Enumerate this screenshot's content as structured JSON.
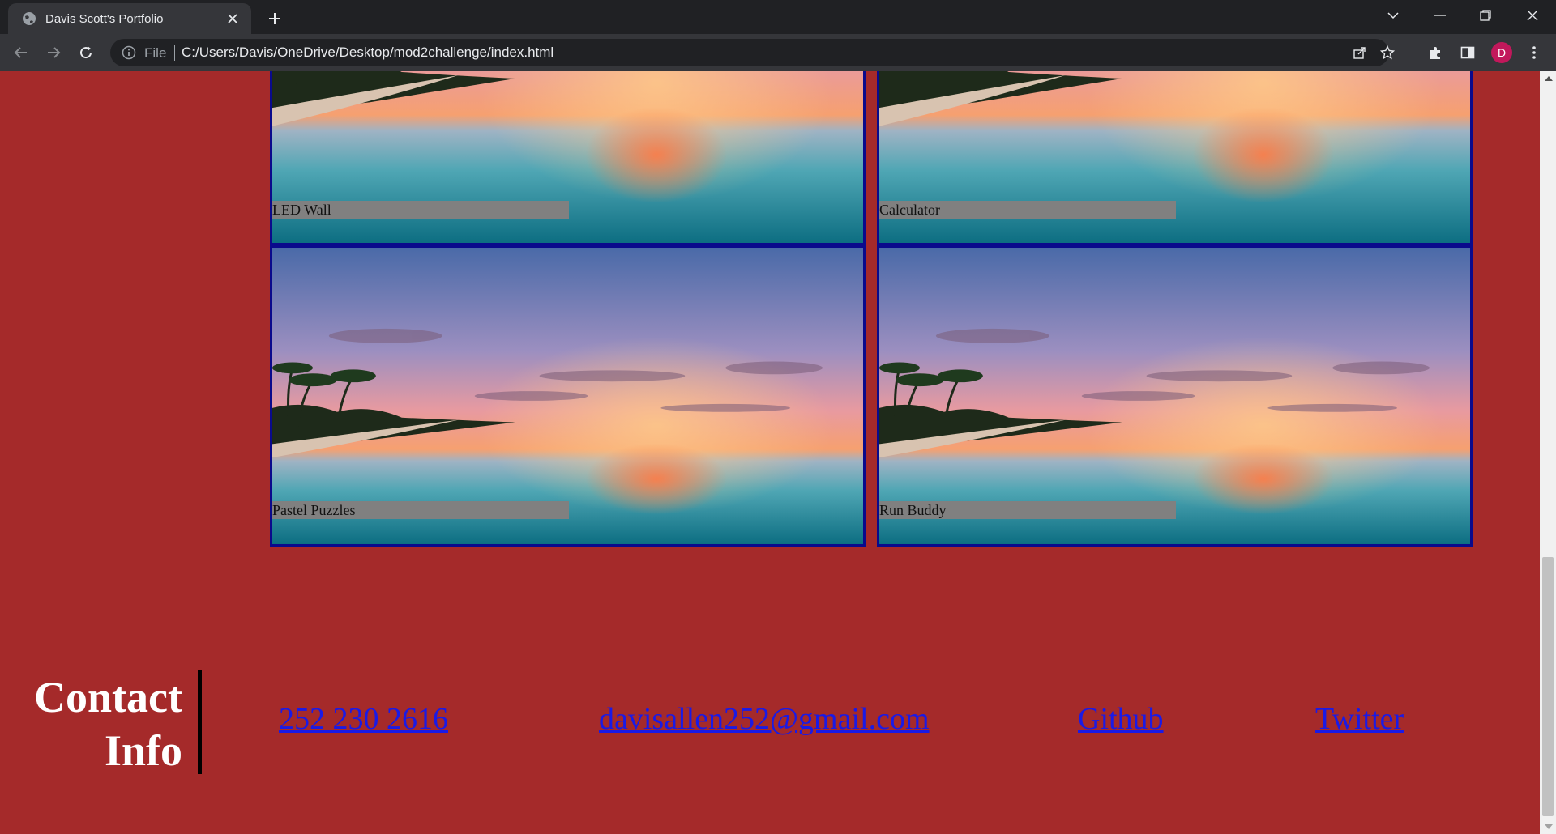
{
  "browser": {
    "tab_title": "Davis Scott's Portfolio",
    "url_scheme_label": "File",
    "url": "C:/Users/Davis/OneDrive/Desktop/mod2challenge/index.html",
    "avatar_initial": "D"
  },
  "projects": [
    {
      "label": "LED Wall"
    },
    {
      "label": "Calculator"
    },
    {
      "label": "Pastel Puzzles"
    },
    {
      "label": "Run Buddy"
    }
  ],
  "contact": {
    "heading_line1": "Contact",
    "heading_line2": "Info",
    "phone": "252 230 2616",
    "email": "davisallen252@gmail.com",
    "github": "Github",
    "twitter": "Twitter"
  },
  "colors": {
    "page_background": "#a52a2a",
    "card_border": "#0a0a8c",
    "label_background": "#808080",
    "link": "#1a1ae6"
  }
}
